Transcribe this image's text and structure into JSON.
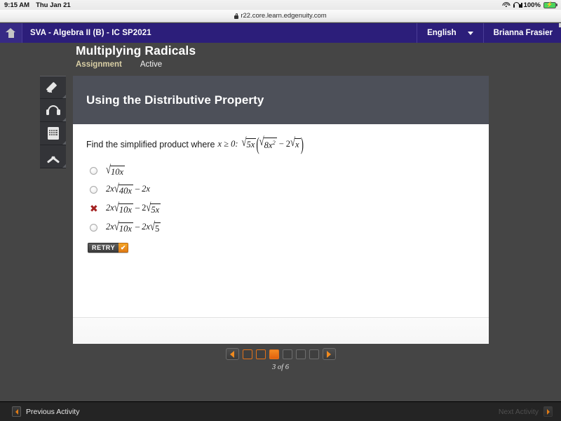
{
  "status_bar": {
    "time": "9:15 AM",
    "date": "Thu Jan 21",
    "wifi_icon": "wifi-icon",
    "headphones_icon": "headphones-icon",
    "battery_percent": "100%",
    "battery_icon": "battery-charging-icon",
    "battery_color": "#49d65d"
  },
  "browser": {
    "lock_icon": "lock-icon",
    "url": "r22.core.learn.edgenuity.com"
  },
  "topnav": {
    "home_icon": "home-icon",
    "course": "SVA - Algebra II (B) - IC SP2021",
    "language": "English",
    "chevron_icon": "chevron-down-icon",
    "user": "Brianna Frasier",
    "background_color": "#2c1e7a"
  },
  "lesson": {
    "title": "Multiplying Radicals",
    "type": "Assignment",
    "status": "Active",
    "type_color": "#d9cfa5"
  },
  "toolrail": [
    {
      "name": "pencil-tool",
      "icon": "pencil-icon"
    },
    {
      "name": "audio-tool",
      "icon": "headphones-icon"
    },
    {
      "name": "calculator-tool",
      "icon": "calculator-icon"
    },
    {
      "name": "collapse-tool",
      "icon": "chevron-up-icon"
    }
  ],
  "card": {
    "header_title": "Using the Distributive Property",
    "header_color": "#4d5059",
    "question": {
      "prefix": "Find the simplified product where",
      "condition": "x ≥ 0:",
      "expression": "√(5x)(√(8x²) − 2√x)",
      "outer_radicand": "5x",
      "inner_first_radicand": "8x",
      "inner_first_exponent": "2",
      "inner_coefficient": "2",
      "inner_second_radicand": "x",
      "inner_operator": "−"
    },
    "options": [
      {
        "id": "option-a",
        "mark": "radio",
        "selected": false,
        "text": "√(10x)",
        "parts": {
          "radicand": "10x"
        }
      },
      {
        "id": "option-b",
        "mark": "radio",
        "selected": false,
        "text": "2x√(40x) − 2x",
        "parts": {
          "coef": "2x",
          "radicand": "40x",
          "op": "–",
          "tail": "2x"
        }
      },
      {
        "id": "option-c",
        "mark": "x",
        "selected": true,
        "text": "2x√(10x) − 2√(5x)",
        "parts": {
          "coef": "2x",
          "radicand": "10x",
          "op": "–",
          "tail_coef": "2",
          "tail_radicand": "5x"
        }
      },
      {
        "id": "option-d",
        "mark": "radio",
        "selected": false,
        "text": "2x√(10x) − 2x√5",
        "parts": {
          "coef": "2x",
          "radicand": "10x",
          "op": "–",
          "tail_coef": "2x",
          "tail_radicand": "5"
        }
      }
    ],
    "incorrect_mark": "✖",
    "retry": {
      "label": "RETRY",
      "check_glyph": "✔",
      "accent_color": "#e3721a"
    }
  },
  "pager": {
    "prev_icon": "triangle-left-icon",
    "next_icon": "triangle-right-icon",
    "boxes": [
      {
        "state": "done"
      },
      {
        "state": "done"
      },
      {
        "state": "current"
      },
      {
        "state": "todo"
      },
      {
        "state": "todo"
      },
      {
        "state": "todo"
      }
    ],
    "count_label": "3 of 6",
    "current_page": 3,
    "total_pages": 6,
    "accent_color": "#e3721a"
  },
  "bottombar": {
    "prev_icon": "triangle-left-icon",
    "prev_label": "Previous Activity",
    "next_label": "Next Activity",
    "next_icon": "triangle-right-icon",
    "next_disabled": true
  }
}
